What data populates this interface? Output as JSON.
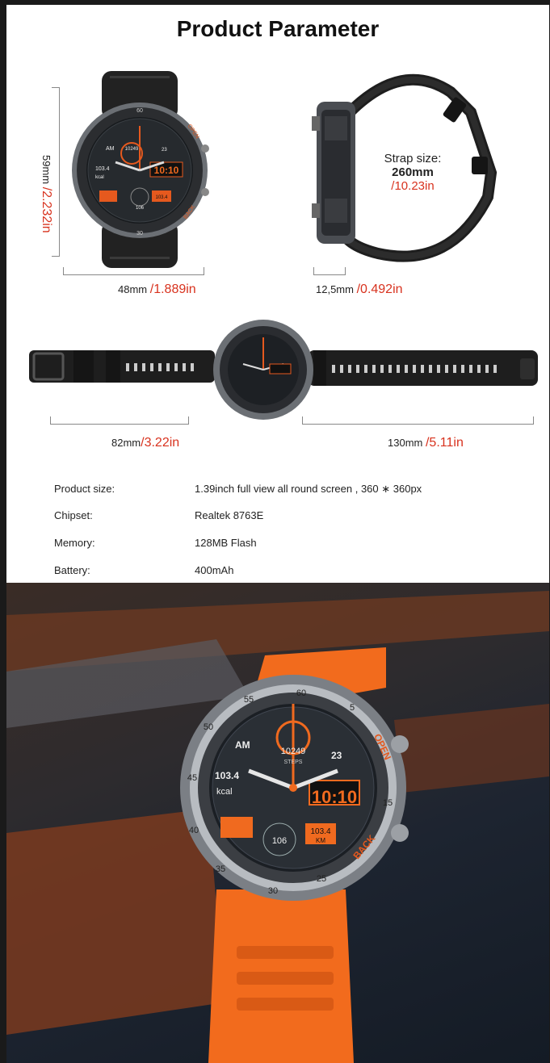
{
  "title": "Product Parameter",
  "dimensions": {
    "height_mm": "59mm",
    "height_in": "/2.232in",
    "width_mm": "48mm",
    "width_in": "/1.889in",
    "thickness_mm": "12,5mm",
    "thickness_in": "/0.492in",
    "strap_label": "Strap size:",
    "strap_mm": "260mm",
    "strap_in": "/10.23in",
    "short_strap_mm": "82mm",
    "short_strap_in": "/3.22in",
    "long_strap_mm": "130mm",
    "long_strap_in": "/5.11in"
  },
  "watch_face": {
    "bezel_60": "60",
    "bezel_55": "55",
    "bezel_50": "50",
    "bezel_45": "45",
    "bezel_40": "40",
    "bezel_35": "35",
    "bezel_30": "30",
    "bezel_25": "25",
    "bezel_5": "5",
    "bezel_15": "15",
    "open": "OPEN",
    "back": "BACK",
    "am": "AM",
    "steps": "10249",
    "steps_label": "STEPS",
    "date": "23",
    "calories": "103.4",
    "kcal": "kcal",
    "time": "10:10",
    "heart": "106",
    "distance": "103.4",
    "km": "KM"
  },
  "specs": [
    {
      "key": "Product size:",
      "value": "1.39inch full view all round screen , 360 ∗ 360px"
    },
    {
      "key": "Chipset:",
      "value": "Realtek 8763E"
    },
    {
      "key": "Memory:",
      "value": "128MB Flash"
    },
    {
      "key": "Battery:",
      "value": "400mAh"
    }
  ],
  "colors": {
    "accent_red": "#d8321e",
    "watch_orange": "#f06a1f",
    "strap_orange": "#f26b1d"
  }
}
